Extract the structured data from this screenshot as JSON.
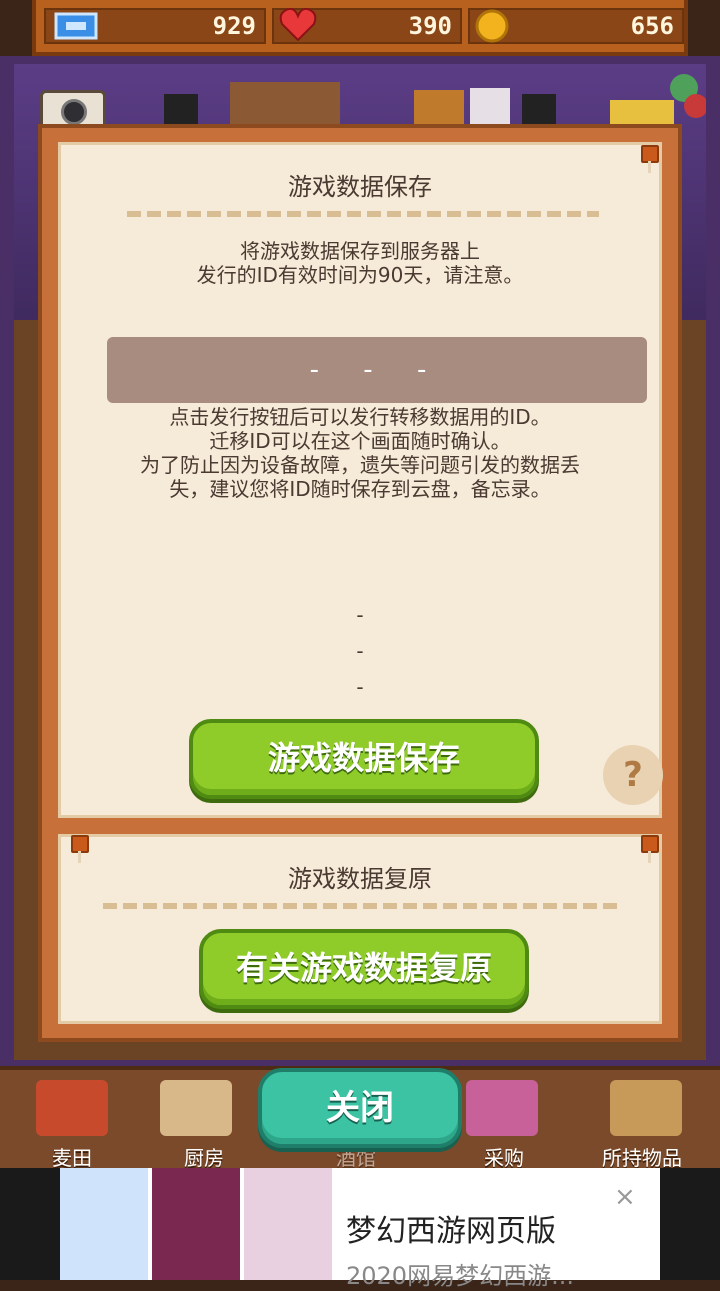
{
  "topbar": {
    "ticket_value": "929",
    "heart_value": "390",
    "coin_value": "656",
    "icons": [
      "ticket-icon",
      "heart-icon",
      "coin-icon"
    ]
  },
  "camera": {
    "label": "照相"
  },
  "save_panel": {
    "title": "游戏数据保存",
    "description": "将游戏数据保存到服务器上\n发行的ID有效时间为90天，请注意。",
    "id_placeholder": "- - -",
    "instructions": "点击发行按钮后可以发行转移数据用的ID。\n迁移ID可以在这个画面随时确认。\n为了防止因为设备故障，遗失等问题引发的数据丢\n失，建议您将ID随时保存到云盘，备忘录。",
    "dashes": [
      "-",
      "-",
      "-"
    ],
    "button_label": "游戏数据保存",
    "help_label": "?"
  },
  "restore_panel": {
    "title": "游戏数据复原",
    "button_label": "有关游戏数据复原"
  },
  "bottom_nav": {
    "items": [
      {
        "label": "麦田"
      },
      {
        "label": "厨房"
      },
      {
        "label": "酒馆"
      },
      {
        "label": "采购"
      },
      {
        "label": "所持物品"
      }
    ],
    "close_label": "关闭"
  },
  "ad": {
    "title": "梦幻西游网页版",
    "subtitle": "2020网易梦幻西游...",
    "close_icon": "×"
  },
  "colors": {
    "dialog_frame": "#c8703a",
    "panel_bg": "#f6ead8",
    "green_button": "#8fcc2a",
    "close_button": "#3cc3a4"
  }
}
